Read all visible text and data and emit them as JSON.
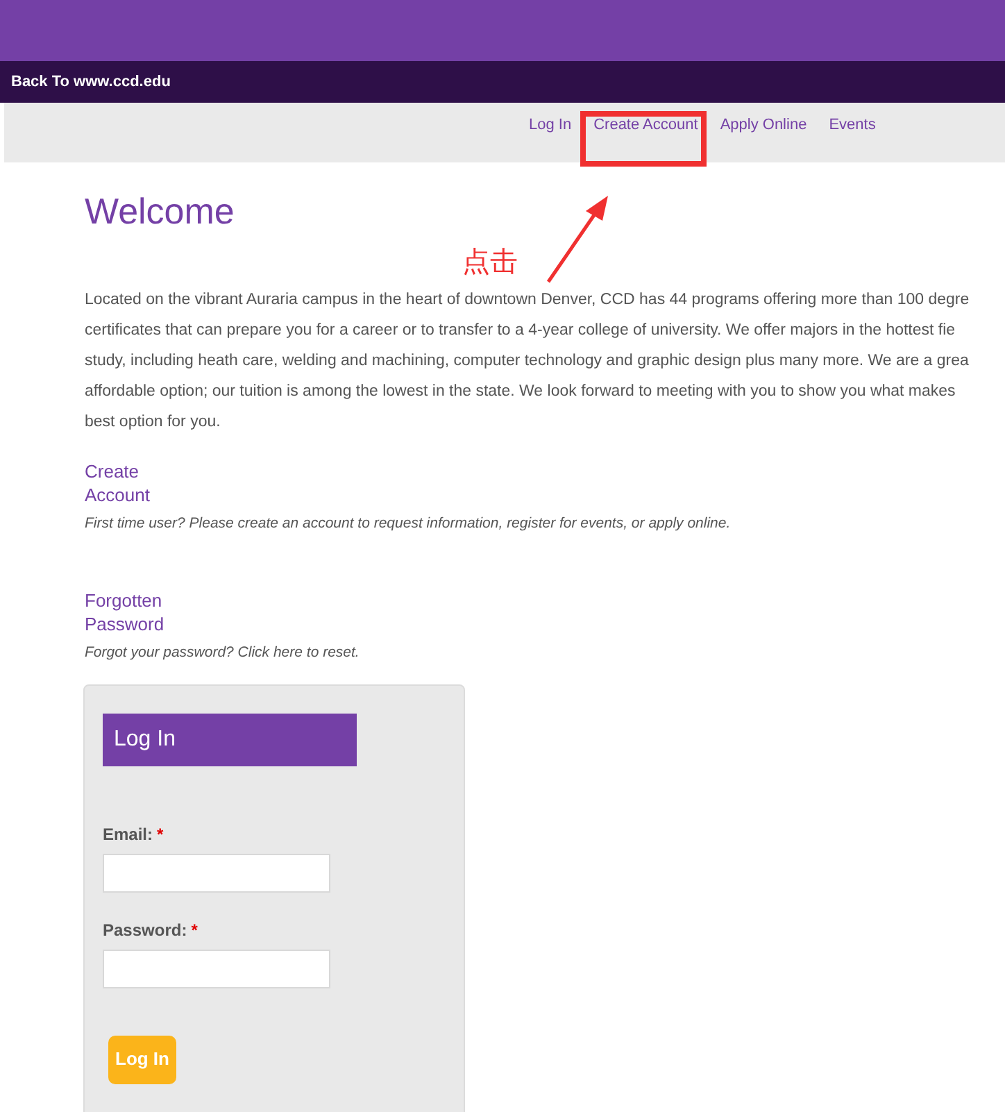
{
  "top_bar": {
    "back_link": "Back To www.ccd.edu"
  },
  "nav": [
    {
      "label": "Log In"
    },
    {
      "label": "Create Account"
    },
    {
      "label": "Apply Online"
    },
    {
      "label": "Events"
    }
  ],
  "annotation": {
    "label": "点击"
  },
  "title": "Welcome",
  "intro_lines": [
    "Located on the vibrant Auraria campus in the heart of downtown Denver, CCD has 44 programs offering more than 100 degre",
    "certificates that can prepare you for a career or to transfer to a 4-year college of university. We offer majors in the hottest fie",
    "study, including heath care, welding and machining, computer technology and graphic design plus many more. We are a grea",
    "affordable option; our tuition is among the lowest in the state. We look forward to meeting with you to show you what makes",
    "best option for you."
  ],
  "links": [
    {
      "label_lines": [
        "Create",
        "Account"
      ],
      "note": "First time user? Please create an account to request information, register for events, or apply online."
    },
    {
      "label_lines": [
        "Forgotten",
        "Password"
      ],
      "note": "Forgot your password? Click here to reset."
    }
  ],
  "login": {
    "heading": "Log In",
    "fields": [
      {
        "label": "Email:",
        "required_mark": "*"
      },
      {
        "label": "Password:",
        "required_mark": "*"
      }
    ],
    "button": "Log In"
  }
}
